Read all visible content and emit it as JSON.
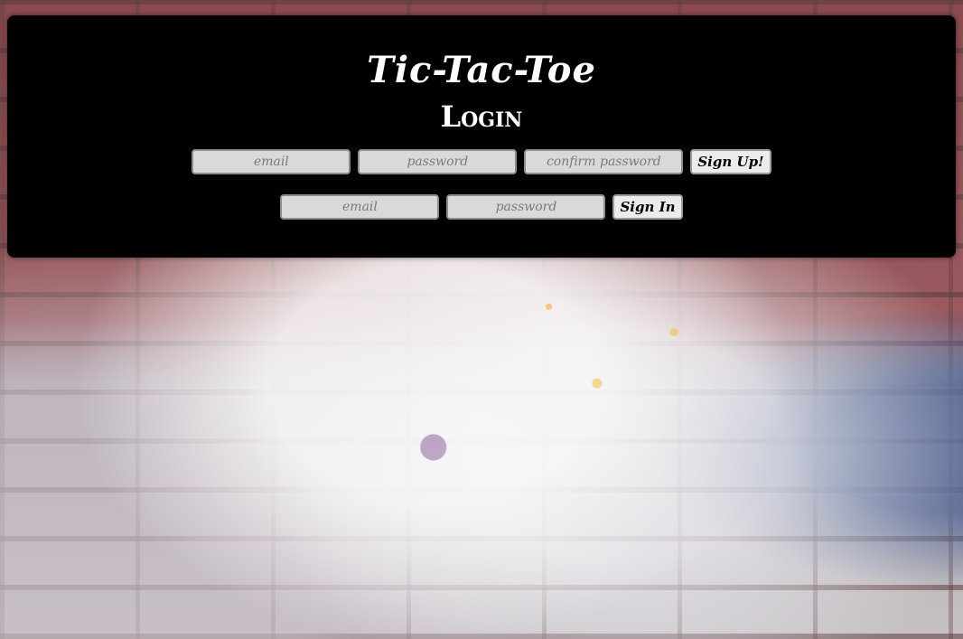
{
  "header": {
    "title": "Tic-Tac-Toe",
    "subtitle": "Login"
  },
  "signup": {
    "email_placeholder": "email",
    "password_placeholder": "password",
    "confirm_placeholder": "confirm password",
    "button_label": "Sign Up!"
  },
  "signin": {
    "email_placeholder": "email",
    "password_placeholder": "password",
    "button_label": "Sign In"
  },
  "colors": {
    "panel_background": "#000000",
    "title_text": "#ffffff",
    "field_background": "#d9d9d9",
    "button_background": "#ececec"
  }
}
